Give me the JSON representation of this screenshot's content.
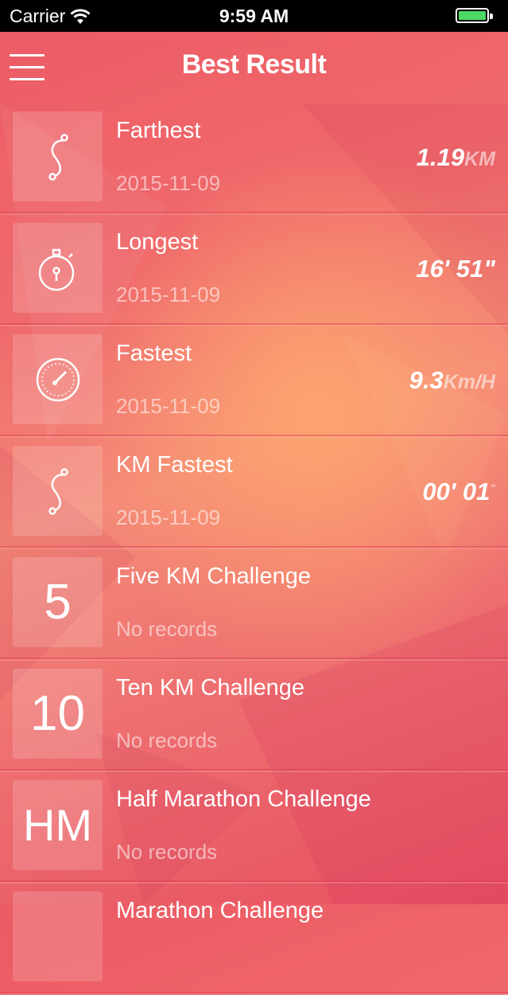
{
  "status_bar": {
    "carrier": "Carrier",
    "time": "9:59 AM",
    "battery_color": "#4cd964"
  },
  "nav": {
    "title": "Best Result",
    "menu_icon": "hamburger-menu-icon"
  },
  "records": [
    {
      "icon": "route-s-icon",
      "title": "Farthest",
      "date": "2015-11-09",
      "value": "1.19",
      "unit": "KM"
    },
    {
      "icon": "stopwatch-icon",
      "title": "Longest",
      "date": "2015-11-09",
      "value": "16' 51\"",
      "unit": ""
    },
    {
      "icon": "speedometer-icon",
      "title": "Fastest",
      "date": "2015-11-09",
      "value": "9.3",
      "unit": "Km/H"
    },
    {
      "icon": "route-s-icon",
      "title": "KM Fastest",
      "date": "2015-11-09",
      "value": "00' 01",
      "unit": "\""
    },
    {
      "tile_text": "5",
      "title": "Five KM Challenge",
      "date": "No records"
    },
    {
      "tile_text": "10",
      "title": "Ten KM Challenge",
      "date": "No records"
    },
    {
      "tile_text": "HM",
      "title": "Half Marathon Challenge",
      "date": "No records"
    },
    {
      "tile_text": "",
      "title": "Marathon Challenge",
      "date": ""
    }
  ],
  "theme": {
    "accent": "#ee6a6c"
  }
}
